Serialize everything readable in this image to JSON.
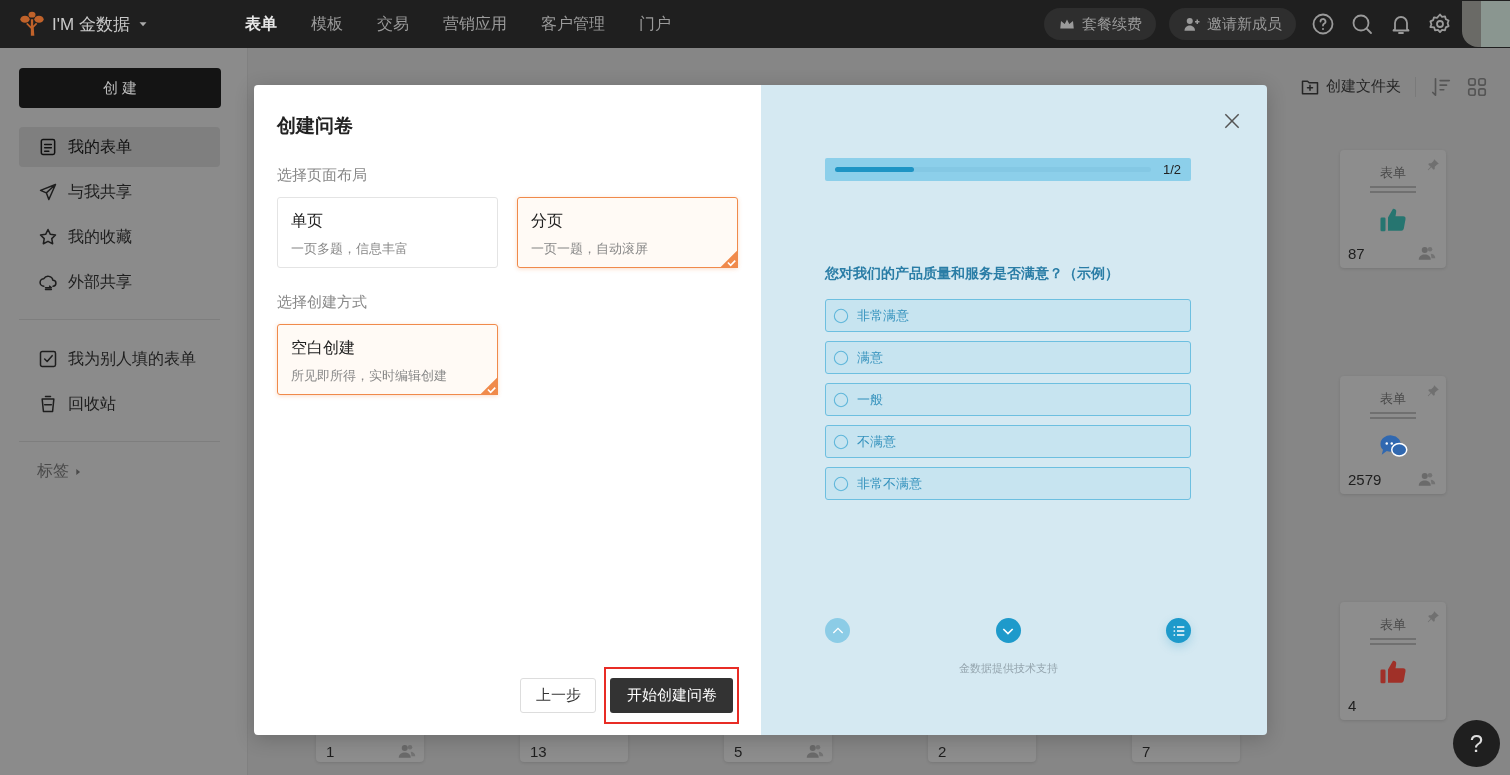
{
  "top_bar": {
    "brand": "I'M 金数据",
    "nav": [
      {
        "label": "表单",
        "selected": true
      },
      {
        "label": "模板",
        "selected": false
      },
      {
        "label": "交易",
        "selected": false
      },
      {
        "label": "营销应用",
        "selected": false
      },
      {
        "label": "客户管理",
        "selected": false
      },
      {
        "label": "门户",
        "selected": false
      }
    ],
    "actions": [
      "套餐续费",
      "邀请新成员"
    ]
  },
  "sidebar": {
    "create_button": "创 建",
    "groups": [
      [
        {
          "label": "我的表单",
          "selected": true
        },
        {
          "label": "与我共享",
          "selected": false
        },
        {
          "label": "我的收藏",
          "selected": false
        },
        {
          "label": "外部共享",
          "selected": false
        }
      ],
      [
        {
          "label": "我为别人填的表单",
          "selected": false
        },
        {
          "label": "回收站",
          "selected": false
        }
      ]
    ],
    "tags": "标签"
  },
  "main": {
    "new_folder": "创建文件夹",
    "cards": [
      {
        "type_label": "表单",
        "count": "87",
        "shared": true,
        "color": "#267570"
      },
      {
        "type_label": "表单",
        "count": "2579",
        "shared": true,
        "color": "#3068b0"
      },
      {
        "type_label": "表单",
        "count": "4",
        "shared": false,
        "color": "#a03028"
      }
    ],
    "partial_cards": [
      {
        "count": "1",
        "shared": true
      },
      {
        "count": "13",
        "shared": false
      },
      {
        "count": "5",
        "shared": true
      },
      {
        "count": "2",
        "shared": false
      },
      {
        "count": "7",
        "shared": false
      }
    ],
    "help_button": "?"
  },
  "dialog": {
    "title": "创建问卷",
    "layout_label": "选择页面布局",
    "layouts": [
      {
        "name": "单页",
        "description": "一页多题，信息丰富",
        "selected": false
      },
      {
        "name": "分页",
        "description": "一页一题，自动滚屏",
        "selected": true
      }
    ],
    "method_label": "选择创建方式",
    "methods": [
      {
        "name": "空白创建",
        "description": "所见即所得，实时编辑创建",
        "selected": true
      }
    ],
    "back_button": "上一步",
    "start_button": "开始创建问卷",
    "preview": {
      "progress": {
        "level": 0.25,
        "text": "1/2"
      },
      "question": "您对我们的产品质量和服务是否满意？（示例）",
      "options": [
        "非常满意",
        "满意",
        "一般",
        "不满意",
        "非常不满意"
      ],
      "previous_disabled": true,
      "footer": "金数据提供技术支持"
    }
  }
}
